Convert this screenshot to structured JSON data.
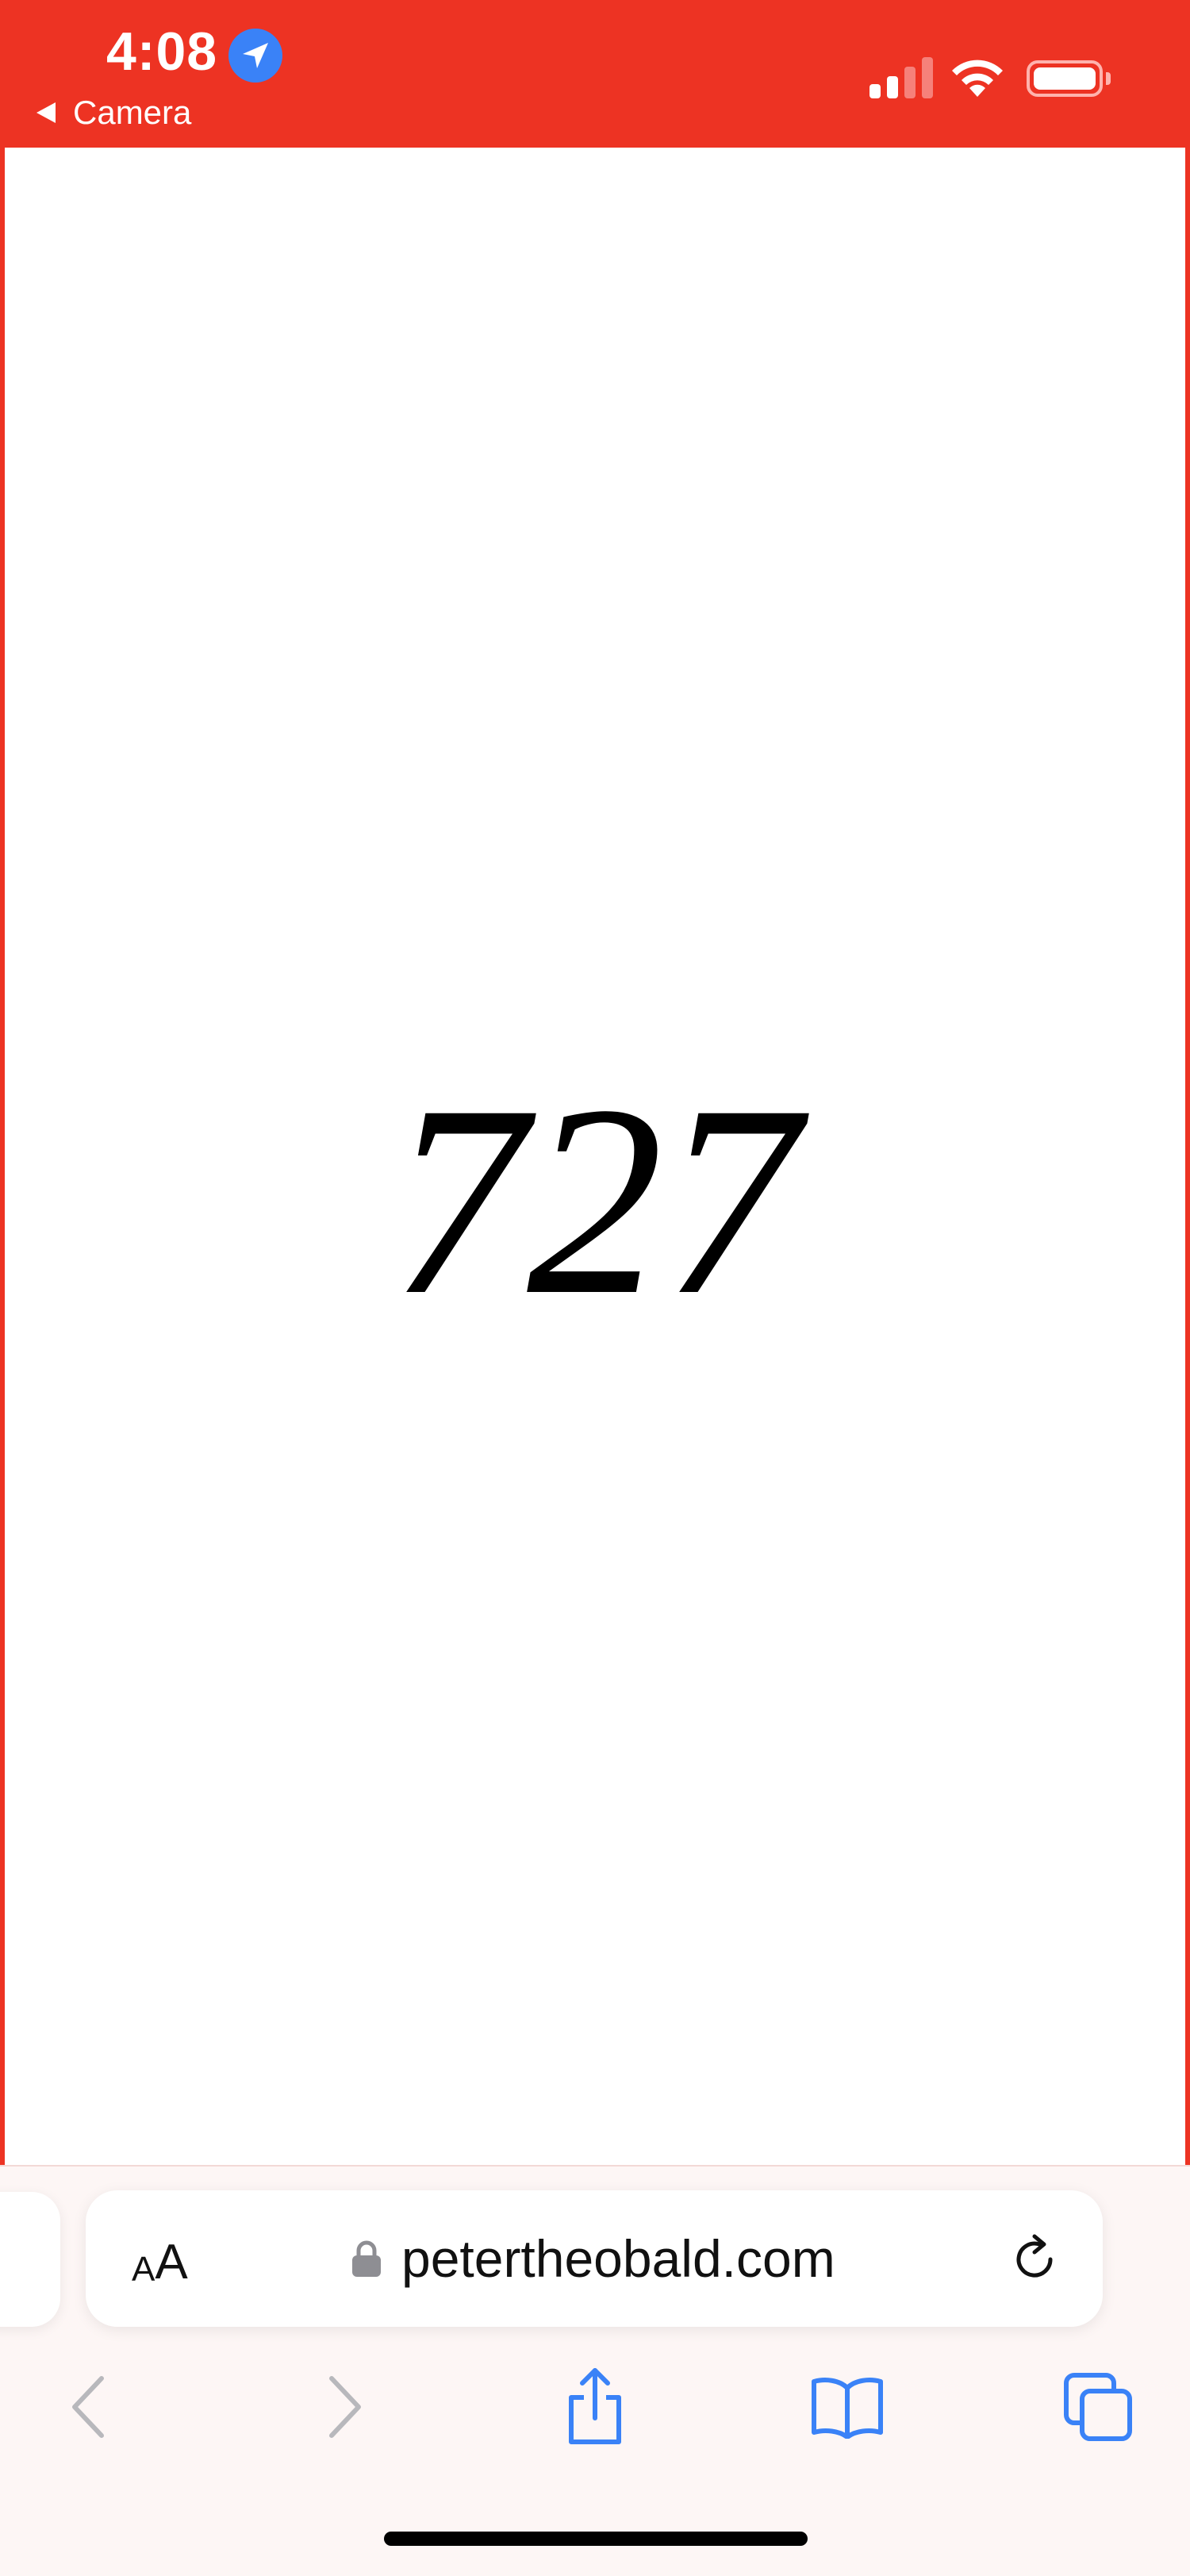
{
  "status_bar": {
    "time": "4:08",
    "back_label": "Camera",
    "location_icon": "location-arrow-icon",
    "signal_icon": "cellular-signal-icon",
    "wifi_icon": "wifi-icon",
    "battery_icon": "battery-icon",
    "background_color": "#ed3323"
  },
  "page": {
    "content_number": "727"
  },
  "address_bar": {
    "aa_small": "A",
    "aa_large": "A",
    "url": "petertheobald.com",
    "lock_icon": "lock-icon",
    "reload_icon": "reload-icon"
  },
  "navigation": {
    "back_icon": "chevron-left-icon",
    "forward_icon": "chevron-right-icon",
    "share_icon": "share-icon",
    "bookmarks_icon": "book-icon",
    "tabs_icon": "tabs-icon",
    "accent_color": "#3a82f7",
    "disabled_color": "#b8b8bc"
  }
}
